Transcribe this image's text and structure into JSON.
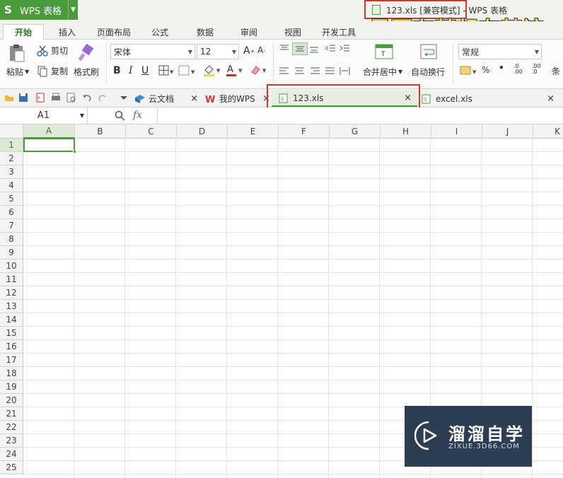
{
  "app": {
    "menu_label": "WPS 表格",
    "logo_glyph": "S"
  },
  "window": {
    "title": "123.xls [兼容模式] - WPS 表格"
  },
  "overlay": {
    "caption": "是要有梦想有梦该"
  },
  "menu_tabs": [
    "开始",
    "插入",
    "页面布局",
    "公式",
    "数据",
    "审阅",
    "视图",
    "开发工具"
  ],
  "ribbon": {
    "paste": "粘贴",
    "cut": "剪切",
    "copy": "复制",
    "format_painter": "格式刷",
    "font_name": "宋体",
    "font_size": "12",
    "merge_center": "合并居中",
    "wrap_text": "自动换行",
    "number_format": "常规",
    "percent": "%",
    "comma": "•",
    "inc_decimal": ".0\n.00",
    "dec_decimal": ".00\n.0",
    "cond_partial": "条"
  },
  "doc_tabs": [
    {
      "label": "云文档"
    },
    {
      "label": "我的WPS"
    },
    {
      "label": "123.xls"
    },
    {
      "label": "excel.xls"
    }
  ],
  "formula_bar": {
    "cell_ref": "A1",
    "fx": "fx"
  },
  "columns": [
    "A",
    "B",
    "C",
    "D",
    "E",
    "F",
    "G",
    "H",
    "I",
    "J",
    "K"
  ],
  "rows": [
    "1",
    "2",
    "3",
    "4",
    "5",
    "6",
    "7",
    "8",
    "9",
    "10",
    "11",
    "12",
    "13",
    "14",
    "15",
    "16",
    "17",
    "18",
    "19",
    "20",
    "21",
    "22",
    "23",
    "24",
    "25"
  ],
  "brand": {
    "name": "溜溜自学",
    "url": "ZIXUE.3D66.COM"
  },
  "colors": {
    "accent": "#4a9c3a",
    "highlight": "#d6352b"
  }
}
